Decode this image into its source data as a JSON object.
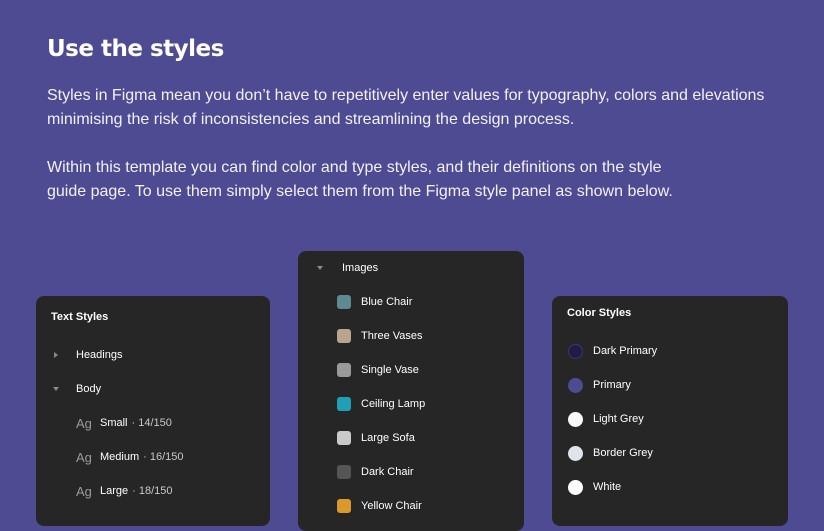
{
  "heading": "Use the styles",
  "paragraph1": "Styles in Figma mean you don’t have to repetitively enter values for typography, colors and elevations minimising the risk of inconsistencies and streamlining the design process.",
  "paragraph2": "Within this template you can find color and type styles, and their definitions on the style guide page. To use them simply select them from the Figma style panel as shown below.",
  "text_styles": {
    "title": "Text Styles",
    "groups": [
      {
        "label": "Headings",
        "expanded": false
      },
      {
        "label": "Body",
        "expanded": true
      }
    ],
    "items": [
      {
        "ag": "Ag",
        "label": "Small",
        "meta": "· 14/150"
      },
      {
        "ag": "Ag",
        "label": "Medium",
        "meta": "· 16/150"
      },
      {
        "ag": "Ag",
        "label": "Large",
        "meta": "· 18/150"
      }
    ]
  },
  "images": {
    "title": "Images",
    "items": [
      {
        "label": "Blue Chair",
        "icon": "blue-chair-thumb",
        "color": "#5b8a93"
      },
      {
        "label": "Three Vases",
        "icon": "three-vases-thumb",
        "color": "#b9a58f"
      },
      {
        "label": "Single Vase",
        "icon": "single-vase-thumb",
        "color": "#9a9a9a"
      },
      {
        "label": "Ceiling Lamp",
        "icon": "ceiling-lamp-thumb",
        "color": "#1fa0b6"
      },
      {
        "label": "Large Sofa",
        "icon": "large-sofa-thumb",
        "color": "#c9c9c9"
      },
      {
        "label": "Dark Chair",
        "icon": "dark-chair-thumb",
        "color": "#555555"
      },
      {
        "label": "Yellow Chair",
        "icon": "yellow-chair-thumb",
        "color": "#d99a2b"
      }
    ]
  },
  "color_styles": {
    "title": "Color Styles",
    "items": [
      {
        "label": "Dark Primary",
        "color": "#1f1d45"
      },
      {
        "label": "Primary",
        "color": "#4e4b93"
      },
      {
        "label": "Light Grey",
        "color": "#f7f7f8"
      },
      {
        "label": "Border Grey",
        "color": "#e2e2ea"
      },
      {
        "label": "White",
        "color": "#ffffff"
      }
    ]
  }
}
